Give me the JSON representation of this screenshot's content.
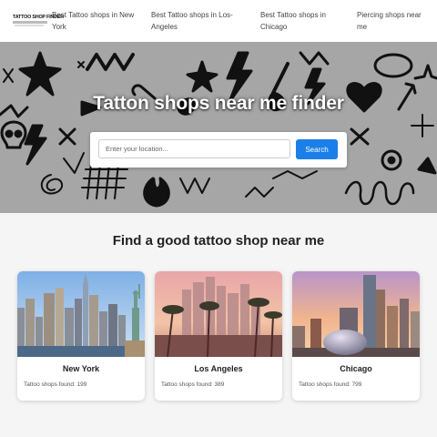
{
  "brand": {
    "logo_text": "TATTOO SHOP FINDER"
  },
  "nav": {
    "links": [
      {
        "label": "Best Tattoo shops in New York"
      },
      {
        "label": "Best Tattoo shops in Los-Angeles"
      },
      {
        "label": "Best Tattoo shops in Chicago"
      },
      {
        "label": "Piercing shops near me"
      }
    ]
  },
  "hero": {
    "title": "Tatton shops near me finder",
    "search": {
      "placeholder": "Enter your location...",
      "button_label": "Search"
    },
    "background_color": "#a6a6a6"
  },
  "section": {
    "title": "Find a good tattoo shop near me"
  },
  "cities": [
    {
      "name": "New York",
      "count_text": "Tattoo shops found: 199"
    },
    {
      "name": "Los Angeles",
      "count_text": "Tattoo shops found: 389"
    },
    {
      "name": "Chicago",
      "count_text": "Tattoo shops found: 799"
    }
  ],
  "colors": {
    "accent": "#1a7fe8",
    "page_bg": "#f5f5f5"
  }
}
